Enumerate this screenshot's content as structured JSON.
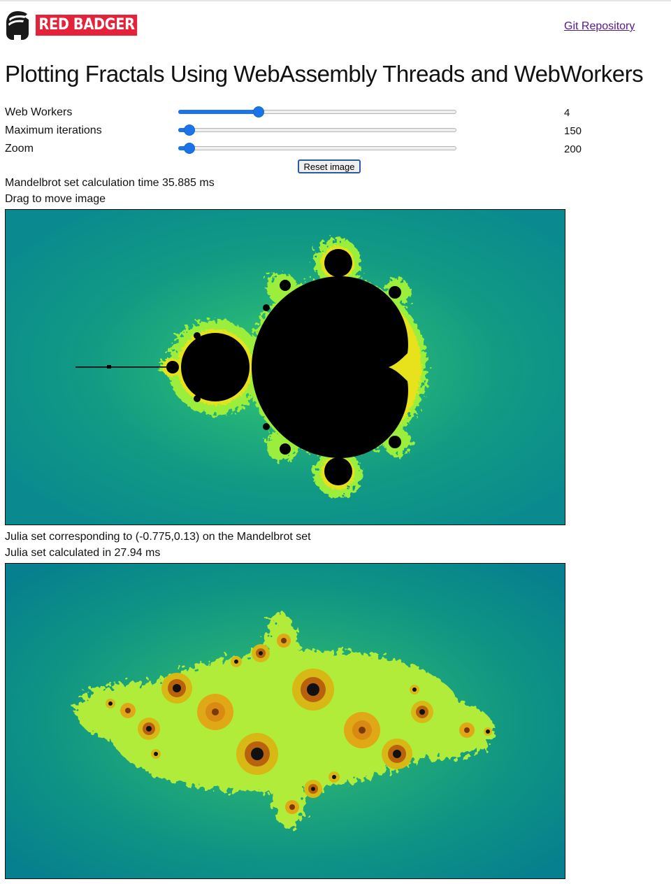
{
  "header": {
    "logo_text": "RED BADGER",
    "logo_icon": "badger-icon",
    "git_link": "Git Repository"
  },
  "page_title": "Plotting Fractals Using WebAssembly Threads and WebWorkers",
  "controls": [
    {
      "label": "Web Workers",
      "value": "4",
      "fraction": 0.28
    },
    {
      "label": "Maximum iterations",
      "value": "150",
      "fraction": 0.02
    },
    {
      "label": "Zoom",
      "value": "200",
      "fraction": 0.02
    }
  ],
  "reset_button": "Reset image",
  "mandelbrot": {
    "calc_time": "Mandelbrot set calculation time 35.885 ms",
    "hint": "Drag to move image"
  },
  "julia": {
    "corresponding": "Julia set corresponding to (-0.775,0.13) on the Mandelbrot set",
    "calc_time": "Julia set calculated in 27.94 ms"
  },
  "colors": {
    "background_teal": "#0c8a8c",
    "fractal_green": "#8ff03c",
    "fractal_yellow": "#f0e21a",
    "set_black": "#000000",
    "accent_blue": "#1a73e8",
    "brand_red": "#e4233b"
  }
}
